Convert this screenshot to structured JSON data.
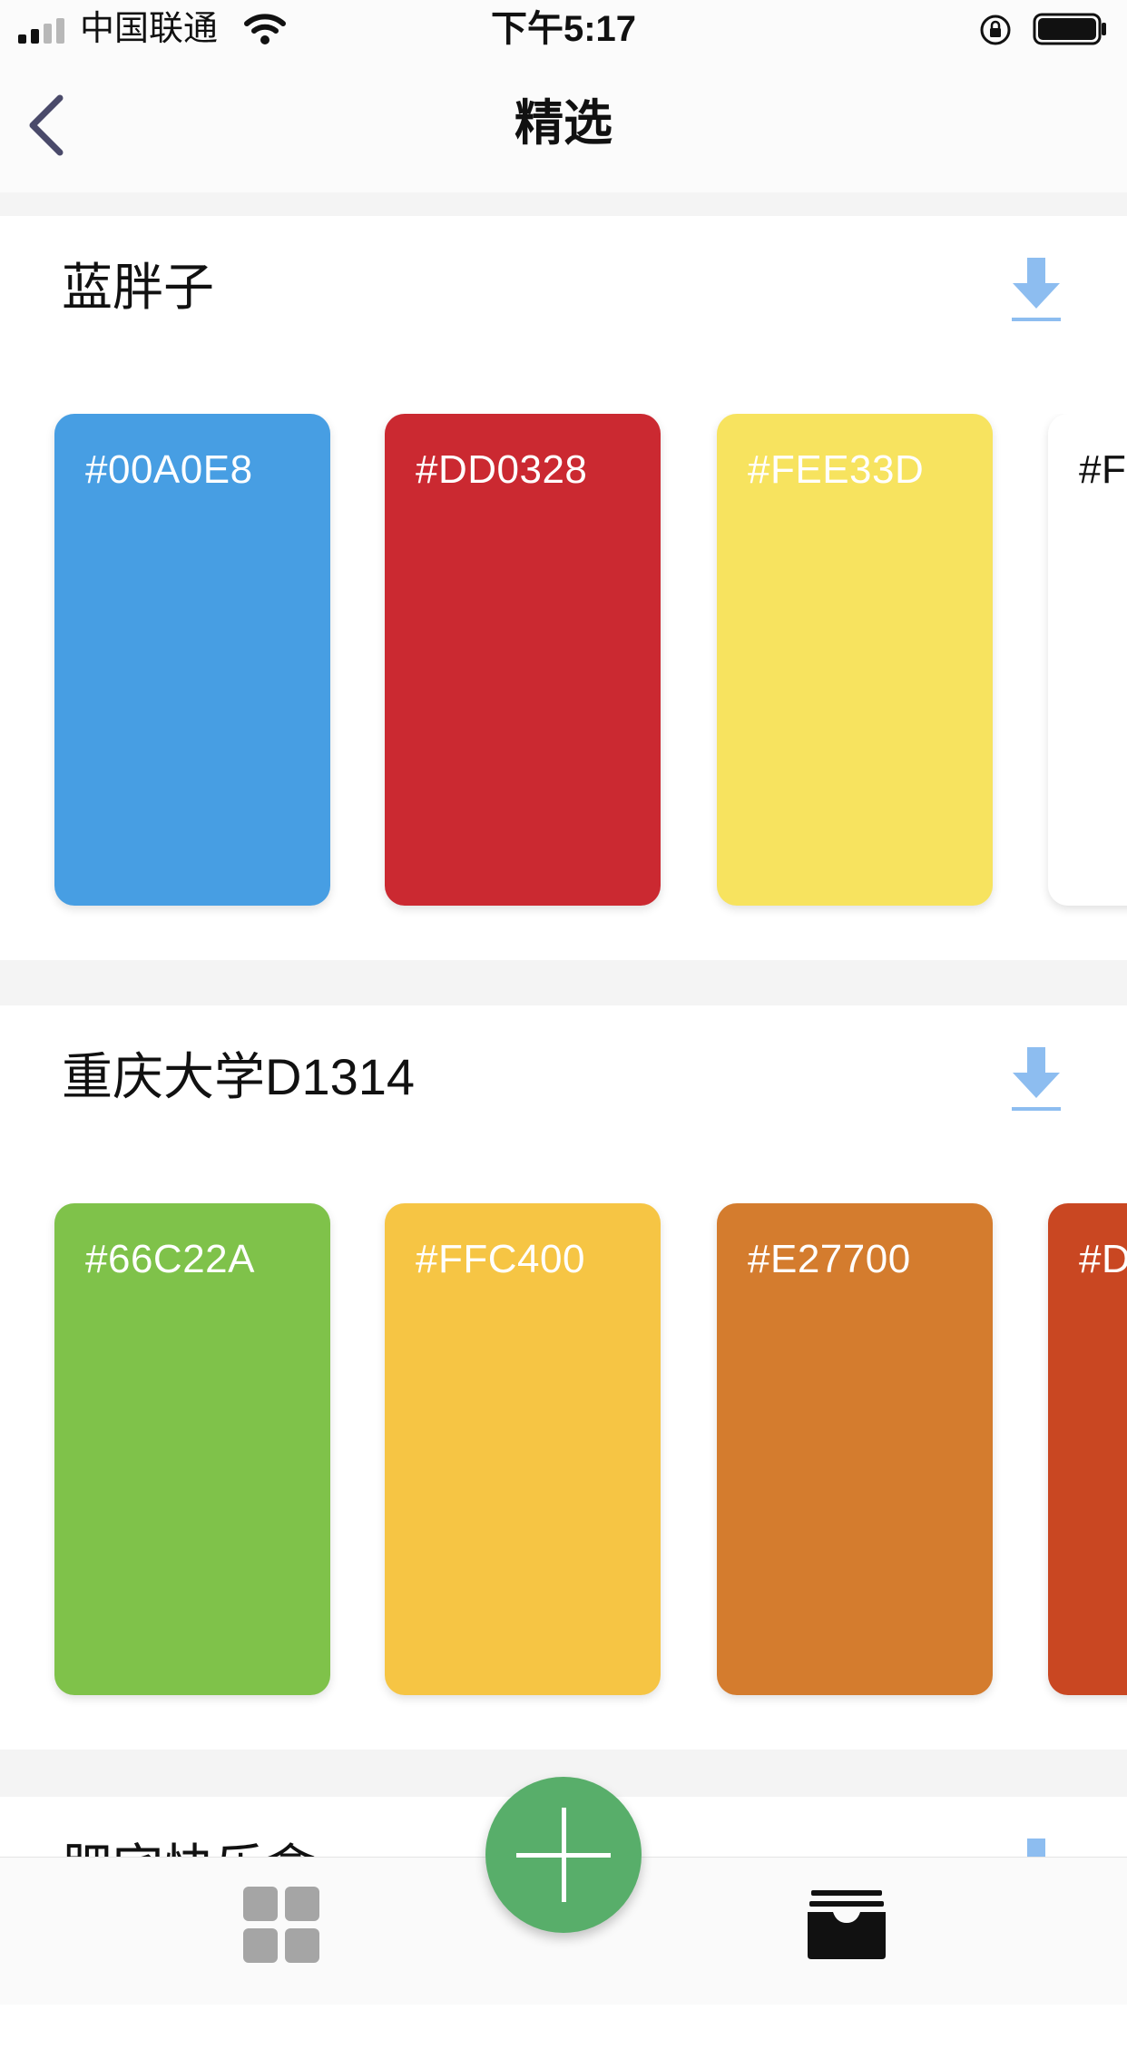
{
  "status_bar": {
    "carrier": "中国联通",
    "time": "下午5:17",
    "signal_bars_active": 2,
    "signal_bars_total": 4,
    "battery_level": 0.95
  },
  "nav": {
    "title": "精选",
    "back_icon": "chevron-left-icon"
  },
  "palettes": [
    {
      "name": "蓝胖子",
      "swatches": [
        {
          "hex": "#00A0E8",
          "color": "#479ee3",
          "text_color": "#ffffff"
        },
        {
          "hex": "#DD0328",
          "color": "#cb2931",
          "text_color": "#ffffff"
        },
        {
          "hex": "#FEE33D",
          "color": "#f7e35f",
          "text_color": "#ffffff"
        },
        {
          "hex": "#F",
          "color": "#ffffff",
          "text_color": "#111111"
        }
      ]
    },
    {
      "name": "重庆大学D1314",
      "swatches": [
        {
          "hex": "#66C22A",
          "color": "#7fc24a",
          "text_color": "#ffffff"
        },
        {
          "hex": "#FFC400",
          "color": "#f6c544",
          "text_color": "#ffffff"
        },
        {
          "hex": "#E27700",
          "color": "#d47c2e",
          "text_color": "#ffffff"
        },
        {
          "hex": "#D",
          "color": "#c94722",
          "text_color": "#ffffff"
        }
      ]
    },
    {
      "name": "肥宅快乐盒",
      "swatches": []
    }
  ],
  "tab_bar": {
    "left_icon": "grid-icon",
    "center_icon": "plus-icon",
    "right_icon": "archive-box-icon",
    "accent_color": "#58ae6a"
  },
  "download_icon_color": "#8dbdf0"
}
